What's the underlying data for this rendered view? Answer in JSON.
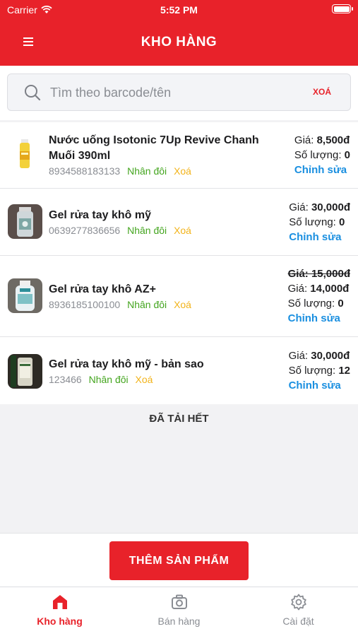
{
  "status_bar": {
    "carrier": "Carrier",
    "time": "5:52 PM"
  },
  "header": {
    "title": "KHO HÀNG"
  },
  "search": {
    "placeholder": "Tìm theo barcode/tên",
    "value": "",
    "clear_label": "XOÁ"
  },
  "products": [
    {
      "name": "Nước uống Isotonic 7Up Revive Chanh Muối 390ml",
      "barcode": "8934588183133",
      "duplicate_label": "Nhân đôi",
      "delete_label": "Xoá",
      "old_price_label": "",
      "price_label": "Giá: ",
      "price": "8,500đ",
      "qty_label": "Số lượng: ",
      "qty": "0",
      "edit_label": "Chỉnh sửa"
    },
    {
      "name": "Gel rửa tay khô mỹ",
      "barcode": "0639277836656",
      "duplicate_label": "Nhân đôi",
      "delete_label": "Xoá",
      "old_price_label": "",
      "price_label": "Giá: ",
      "price": "30,000đ",
      "qty_label": "Số lượng: ",
      "qty": "0",
      "edit_label": "Chỉnh sửa"
    },
    {
      "name": "Gel rửa tay khô AZ+",
      "barcode": "8936185100100",
      "duplicate_label": "Nhân đôi",
      "delete_label": "Xoá",
      "old_price_label": "Giá: 15,000đ",
      "price_label": "Giá: ",
      "price": "14,000đ",
      "qty_label": "Số lượng: ",
      "qty": "0",
      "edit_label": "Chỉnh sửa"
    },
    {
      "name": "Gel rửa tay khô mỹ - bản sao",
      "barcode": "123466",
      "duplicate_label": "Nhân đôi",
      "delete_label": "Xoá",
      "old_price_label": "",
      "price_label": "Giá: ",
      "price": "30,000đ",
      "qty_label": "Số lượng: ",
      "qty": "12",
      "edit_label": "Chỉnh sửa"
    }
  ],
  "list_end_label": "ĐÃ TẢI HẾT",
  "add_button_label": "THÊM SẢN PHẨM",
  "tabs": [
    {
      "label": "Kho hàng",
      "icon": "home-icon",
      "active": true
    },
    {
      "label": "Bán hàng",
      "icon": "camera-icon",
      "active": false
    },
    {
      "label": "Cài đặt",
      "icon": "gear-icon",
      "active": false
    }
  ],
  "colors": {
    "brand": "#e8222a",
    "duplicate": "#44a51f",
    "delete": "#f2b31a",
    "edit": "#1a8fe0"
  }
}
